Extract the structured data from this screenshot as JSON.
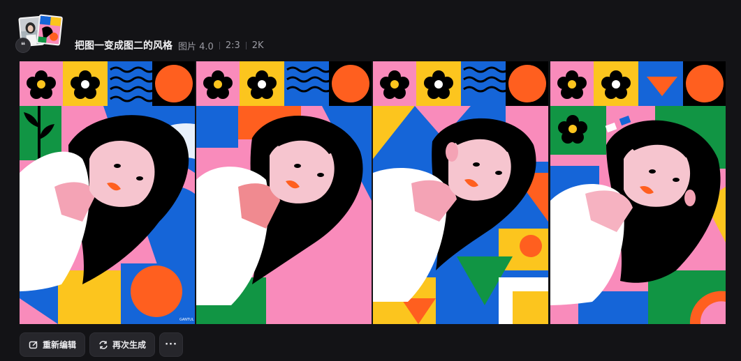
{
  "header": {
    "title": "把图一变成图二的风格",
    "model": "图片 4.0",
    "ratio": "2:3",
    "resolution": "2K",
    "badge_glyph": "❝"
  },
  "gallery": {
    "count": 4,
    "style_colors": [
      "#f98bbb",
      "#fcc51e",
      "#ff5f1f",
      "#1565d8",
      "#119544",
      "#000000",
      "#ffffff"
    ],
    "signature": "GANTUL"
  },
  "actions": {
    "edit_label": "重新编辑",
    "regenerate_label": "再次生成",
    "more_label": "···"
  },
  "icons": {
    "edit": "edit-icon",
    "regenerate": "refresh-icon",
    "more": "more-icon"
  }
}
